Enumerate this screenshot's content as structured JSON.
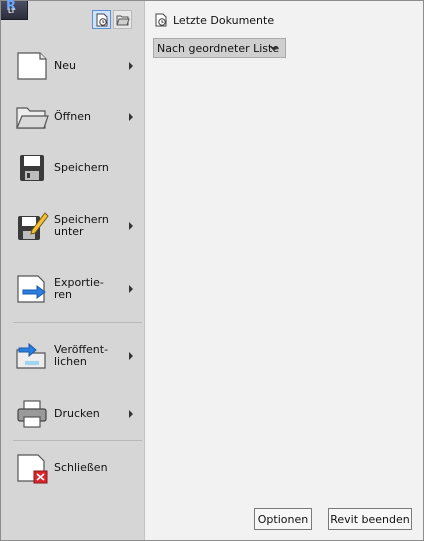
{
  "app": {
    "logo_letter": "R",
    "logo_sub": "LT"
  },
  "toolbar": {
    "recent_view": "recent-documents-icon",
    "open_view": "open-documents-icon"
  },
  "menu": {
    "items": [
      {
        "label": "Neu",
        "icon": "new-document-icon",
        "submenu": true
      },
      {
        "label": "Öffnen",
        "icon": "open-folder-icon",
        "submenu": true
      },
      {
        "label": "Speichern",
        "icon": "save-icon",
        "submenu": false
      },
      {
        "label": "Speichern\nunter",
        "icon": "save-as-icon",
        "submenu": true
      },
      {
        "label": "Exportie-\nren",
        "icon": "export-icon",
        "submenu": true
      },
      {
        "label": "Veröffent-\nlichen",
        "icon": "publish-icon",
        "submenu": true
      },
      {
        "label": "Drucken",
        "icon": "print-icon",
        "submenu": true
      },
      {
        "label": "Schließen",
        "icon": "close-document-icon",
        "submenu": false
      }
    ]
  },
  "recent": {
    "title": "Letzte Dokumente",
    "sort_value": "Nach geordneter Liste"
  },
  "footer": {
    "options_label": "Optionen",
    "exit_label": "Revit beenden"
  },
  "colors": {
    "menu_bg": "#d6d6d6",
    "content_bg": "#f2f2f2",
    "toggle_active": "#cde3ff",
    "accent_blue": "#2a7de1",
    "close_red": "#d9262a"
  }
}
